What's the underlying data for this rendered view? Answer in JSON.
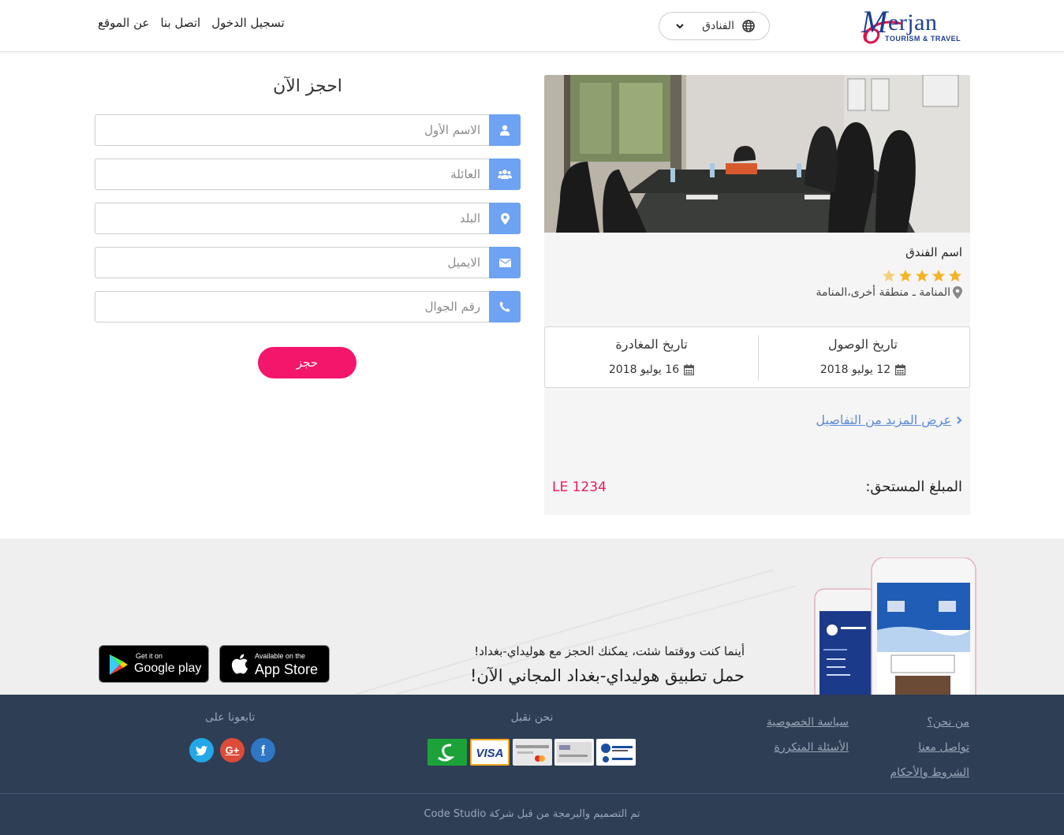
{
  "header": {
    "logo_text": "erjan",
    "logo_tagline": "TOURISM & TRAVEL",
    "category_select": "الفنادق",
    "nav": [
      "عن الموقع",
      "اتصل بنا",
      "تسجيل الدخول"
    ]
  },
  "hotel": {
    "name": "اسم الفندق",
    "stars": 4.5,
    "location": "المنامة ـ منطقة أخرى،المنامة",
    "arrival_title": "تاريخ الوصول",
    "arrival_date": "12 يوليو 2018",
    "departure_title": "تاريخ المغادرة",
    "departure_date": "16 يوليو 2018",
    "more_details": "عرض المزيد من التفاصيل",
    "total_label": "المبلغ المستحق:",
    "total_value": "LE 1234"
  },
  "form": {
    "title": "احجز الآن",
    "fields": [
      {
        "placeholder": "الاسم الأول",
        "icon": "user-icon"
      },
      {
        "placeholder": "العائلة",
        "icon": "users-icon"
      },
      {
        "placeholder": "البلد",
        "icon": "map-marker-icon"
      },
      {
        "placeholder": "الايميل",
        "icon": "envelope-icon"
      },
      {
        "placeholder": "رقم الجوال",
        "icon": "phone-icon"
      }
    ],
    "submit": "حجز"
  },
  "app_banner": {
    "subtitle": "أينما كنت ووقتما شئت، يمكنك الحجز مع هوليداي-بغداد!",
    "title": "حمل تطبيق هوليداي-بغداد المجاني الآن!",
    "google_small": "Get it on",
    "google_big": "Google play",
    "apple_small": "Available on the",
    "apple_big": "App Store"
  },
  "footer": {
    "links_col1": [
      "من نحن؟",
      "تواصل معنا",
      "الشروط والأحكام"
    ],
    "links_col2": [
      "سياسة الخصوصية",
      "الأسئلة المتكررة"
    ],
    "payments_title": "نحن نقبل",
    "follow_title": "تابعونا على",
    "social": [
      "facebook-icon",
      "google-plus-icon",
      "twitter-icon"
    ],
    "copyright": "تم التصميم والبرمجة من قبل شركة Code Studio"
  },
  "colors": {
    "accent_blue": "#6ea2f2",
    "brand_pink": "#f3166b",
    "price_red": "#e8195d",
    "footer_bg": "#2e3e55",
    "star_gold": "#f5b324"
  }
}
